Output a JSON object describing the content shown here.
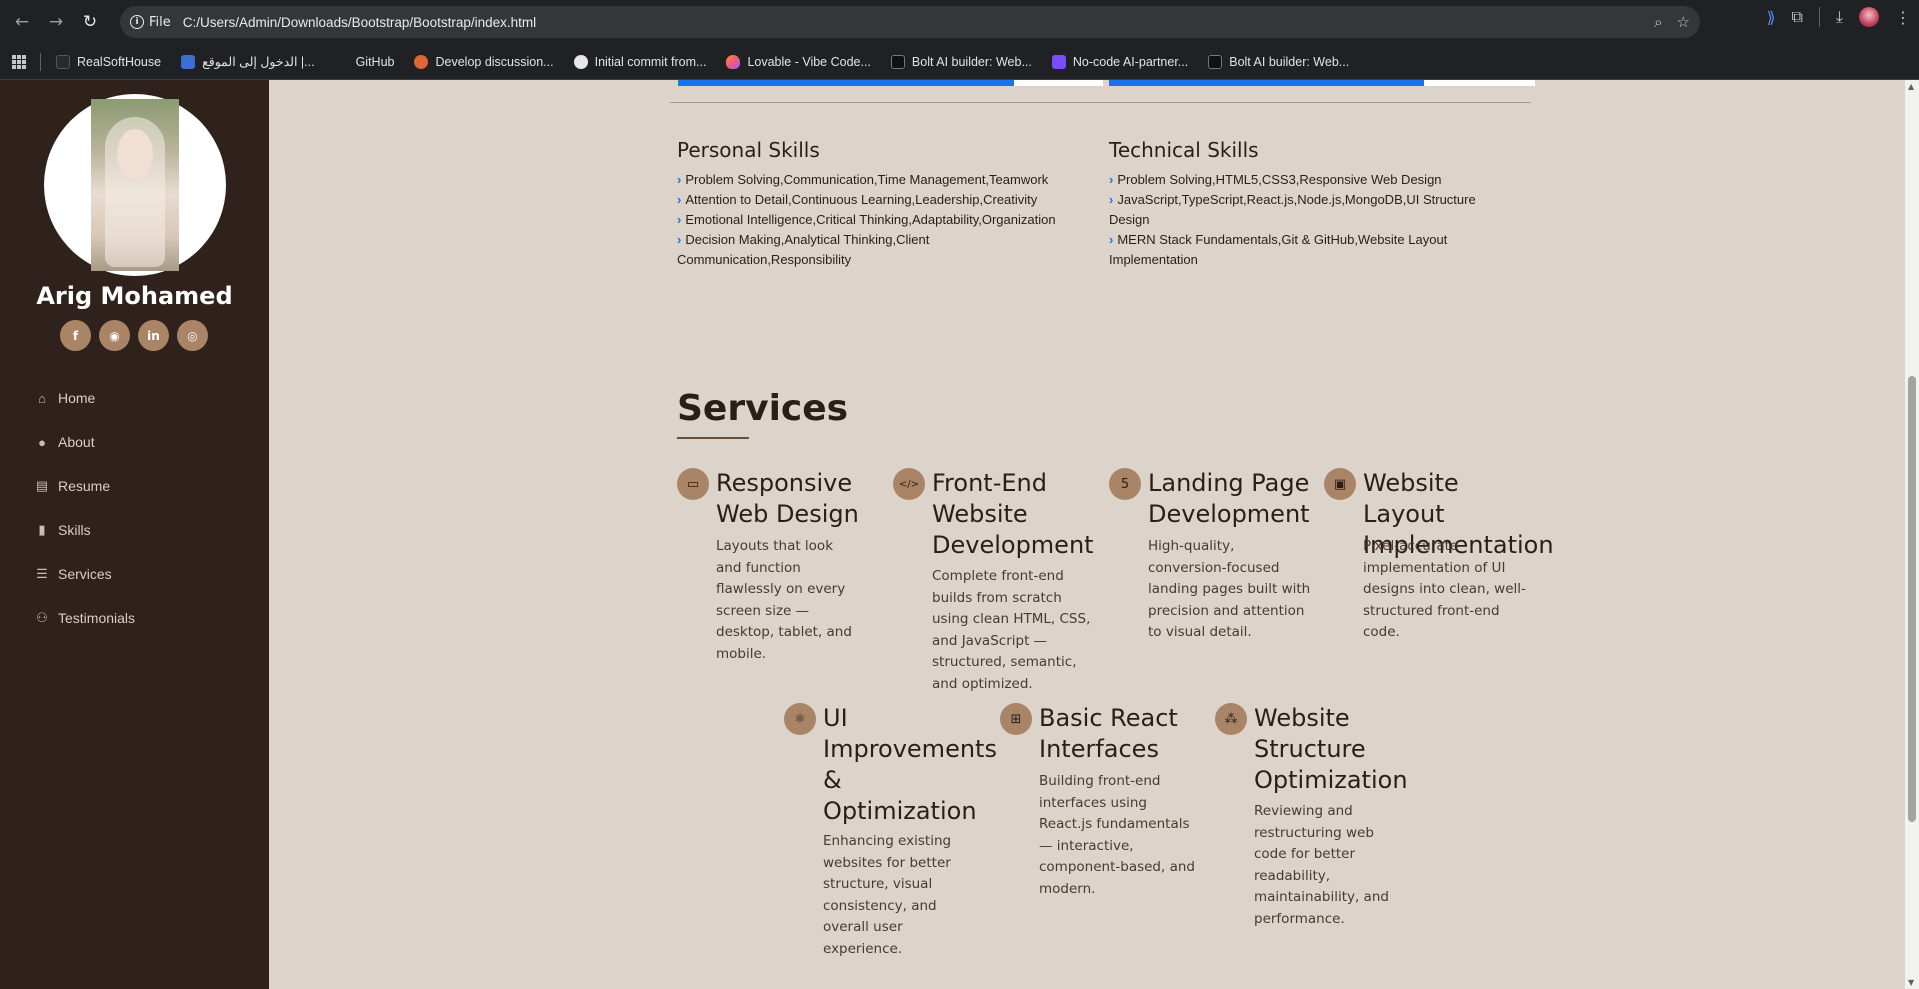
{
  "browser": {
    "protocol_label": "File",
    "url": "C:/Users/Admin/Downloads/Bootstrap/Bootstrap/index.html",
    "bookmarks": [
      {
        "label": "RealSoftHouse",
        "color": "#2a2a2a"
      },
      {
        "label": "الدخول إلى الموقع |...",
        "color": "#3b6fd1"
      },
      {
        "label": "GitHub",
        "color": "#202124"
      },
      {
        "label": "Develop discussion...",
        "color": "#e0663a"
      },
      {
        "label": "Initial commit from...",
        "color": "#e8e8e8"
      },
      {
        "label": "Lovable - Vibe Code...",
        "color": "#f05a78"
      },
      {
        "label": "Bolt AI builder: Web...",
        "color": "#111111"
      },
      {
        "label": "No-code AI-partner...",
        "color": "#7a4cff"
      },
      {
        "label": "Bolt AI builder: Web...",
        "color": "#111111"
      }
    ]
  },
  "profile": {
    "name": "Arig Mohamed",
    "socials": [
      {
        "name": "facebook",
        "glyph": "f"
      },
      {
        "name": "github",
        "glyph": "◉"
      },
      {
        "name": "linkedin",
        "glyph": "in"
      },
      {
        "name": "instagram",
        "glyph": "◎"
      }
    ]
  },
  "nav": [
    {
      "label": "Home",
      "icon": "home-icon",
      "glyph": "⌂"
    },
    {
      "label": "About",
      "icon": "person-icon",
      "glyph": "●"
    },
    {
      "label": "Resume",
      "icon": "file-icon",
      "glyph": "▤"
    },
    {
      "label": "Skills",
      "icon": "book-icon",
      "glyph": "▮"
    },
    {
      "label": "Services",
      "icon": "server-icon",
      "glyph": "☰"
    },
    {
      "label": "Testimonials",
      "icon": "users-icon",
      "glyph": "⚇"
    }
  ],
  "progress": [
    {
      "fraction": 0.79
    },
    {
      "fraction": 0.74
    }
  ],
  "skills": {
    "personal": {
      "title": "Personal Skills",
      "items": [
        "Problem Solving,Communication,Time Management,Teamwork",
        "Attention to Detail,Continuous Learning,Leadership,Creativity",
        "Emotional Intelligence,Critical Thinking,Adaptability,Organization",
        "Decision Making,Analytical Thinking,Client Communication,Responsibility"
      ]
    },
    "technical": {
      "title": "Technical Skills",
      "items": [
        "Problem Solving,HTML5,CSS3,Responsive Web Design",
        "JavaScript,TypeScript,React.js,Node.js,MongoDB,UI Structure Design",
        "MERN Stack Fundamentals,Git & GitHub,Website Layout Implementation"
      ]
    }
  },
  "services": {
    "title": "Services",
    "items": [
      {
        "title": "Responsive Web Design",
        "desc": "Layouts that look and function flawlessly on every screen size — desktop, tablet, and mobile.",
        "icon": "laptop-icon",
        "glyph": "▭"
      },
      {
        "title": "Front-End Website Development",
        "desc": "Complete front-end builds from scratch using clean HTML, CSS, and JavaScript — structured, semantic, and optimized.",
        "icon": "code-icon",
        "glyph": "</>"
      },
      {
        "title": "Landing Page Development",
        "desc": "High-quality, conversion-focused landing pages built with precision and attention to visual detail.",
        "icon": "html5-icon",
        "glyph": "5"
      },
      {
        "title": "Website Layout Implementation",
        "desc": "Pixel-accurate implementation of UI designs into clean, well-structured front-end code.",
        "icon": "layout-icon",
        "glyph": "▣"
      },
      {
        "title": "UI Improvements & Optimization",
        "desc": "Enhancing existing websites for better structure, visual consistency, and overall user experience.",
        "icon": "react-icon",
        "glyph": "⚛"
      },
      {
        "title": "Basic React Interfaces",
        "desc": "Building front-end interfaces using React.js fundamentals — interactive, component-based, and modern.",
        "icon": "sitemap-icon",
        "glyph": "⊞"
      },
      {
        "title": "Website Structure Optimization",
        "desc": "Reviewing and restructuring web code for better readability, maintainability, and performance.",
        "icon": "hierarchy-icon",
        "glyph": "⁂"
      }
    ]
  }
}
